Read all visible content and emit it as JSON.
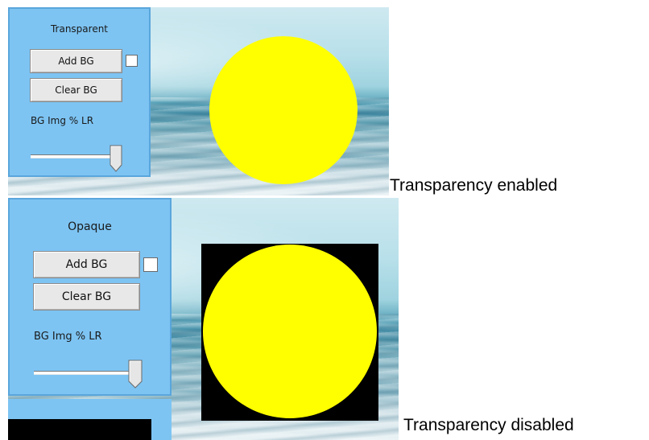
{
  "examples": [
    {
      "panel": {
        "mode_label": "Transparent",
        "add_bg_label": "Add BG",
        "clear_bg_label": "Clear BG",
        "slider_label": "BG Img % LR",
        "checkbox_checked": false,
        "slider_level": 0.95
      },
      "sun": {
        "color": "#ffff00",
        "background": "transparent"
      },
      "caption": "Transparency enabled"
    },
    {
      "panel": {
        "mode_label": "Opaque",
        "add_bg_label": "Add BG",
        "clear_bg_label": "Clear BG",
        "slider_label": "BG Img % LR",
        "checkbox_checked": false,
        "slider_level": 0.95
      },
      "sun": {
        "color": "#ffff00",
        "background": "#000000"
      },
      "caption": "Transparency disabled"
    }
  ],
  "colors": {
    "panel": "#7dc4f3",
    "button": "#e8e8e8",
    "sun": "#ffff00"
  }
}
